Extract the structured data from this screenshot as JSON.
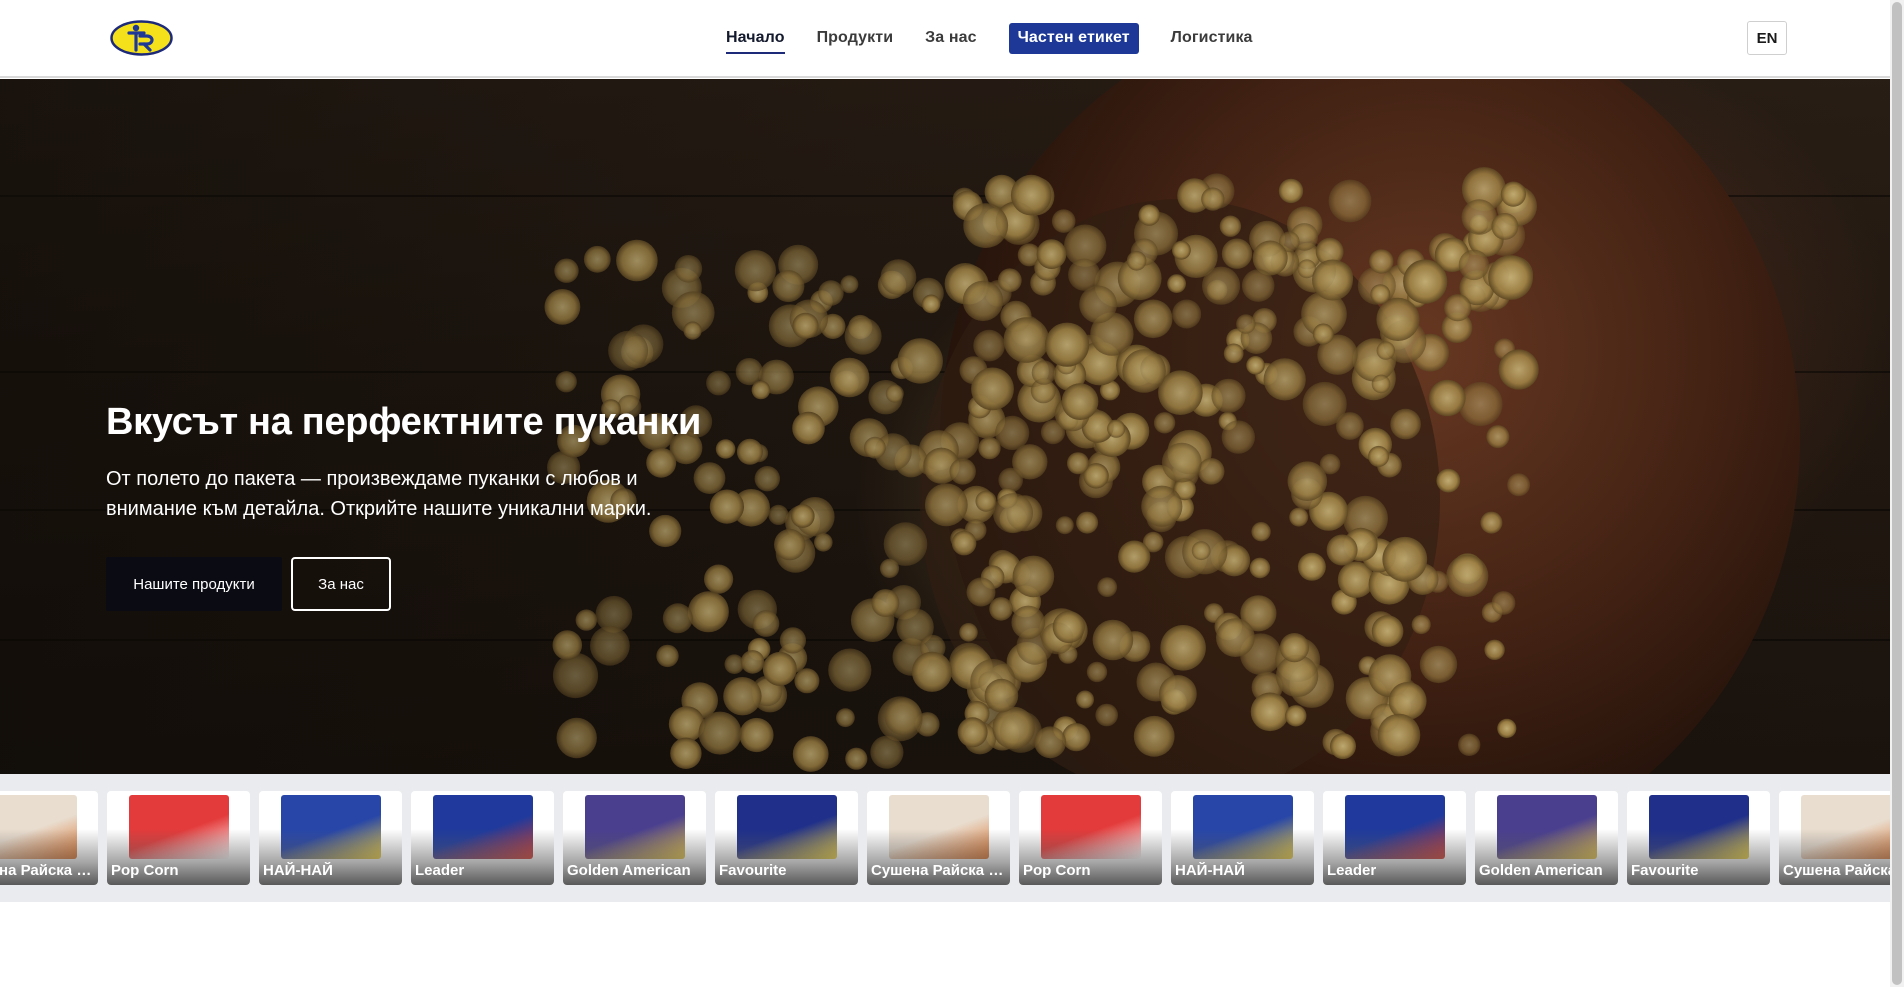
{
  "header": {
    "nav": [
      {
        "label": "Начало",
        "active": true
      },
      {
        "label": "Продукти"
      },
      {
        "label": "За нас"
      },
      {
        "label": "Частен етикет",
        "primary": true
      },
      {
        "label": "Логистика"
      }
    ],
    "lang": "EN"
  },
  "hero": {
    "title": "Вкусът на перфектните пуканки",
    "subtitle": "От полето до пакета — произвеждаме пуканки с любов и внимание към детайла. Открийте нашите уникални марки.",
    "primary_button": "Нашите продукти",
    "secondary_button": "За нас"
  },
  "products": [
    {
      "name": "Сушена Райска ябълка",
      "color": "#e9ddcf",
      "accent": "#d9702a"
    },
    {
      "name": "Pop Corn",
      "color": "#e33b3b",
      "accent": "#ffffff"
    },
    {
      "name": "НАЙ-НАЙ",
      "color": "#2746a8",
      "accent": "#f3d23a"
    },
    {
      "name": "Leader",
      "color": "#1f3a9c",
      "accent": "#d63a2a"
    },
    {
      "name": "Golden American",
      "color": "#4a3f8f",
      "accent": "#e8c540"
    },
    {
      "name": "Favourite",
      "color": "#1f2f8a",
      "accent": "#f1d43b"
    },
    {
      "name": "Сушена Райска ябълка",
      "color": "#e9ddcf",
      "accent": "#d9702a"
    },
    {
      "name": "Pop Corn",
      "color": "#e33b3b",
      "accent": "#ffffff"
    },
    {
      "name": "НАЙ-НАЙ",
      "color": "#2746a8",
      "accent": "#f3d23a"
    },
    {
      "name": "Leader",
      "color": "#1f3a9c",
      "accent": "#d63a2a"
    },
    {
      "name": "Golden American",
      "color": "#4a3f8f",
      "accent": "#e8c540"
    },
    {
      "name": "Favourite",
      "color": "#1f2f8a",
      "accent": "#f1d43b"
    },
    {
      "name": "Сушена Райска ябълка",
      "color": "#e9ddcf",
      "accent": "#d9702a"
    }
  ],
  "colors": {
    "brand_blue": "#1d3896",
    "logo_yellow": "#f5e11b"
  }
}
